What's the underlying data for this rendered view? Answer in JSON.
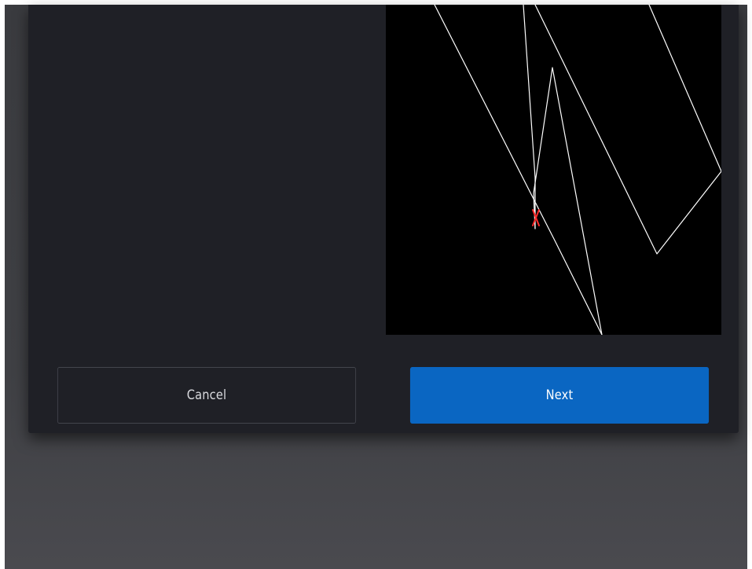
{
  "dialog": {
    "buttons": {
      "cancel_label": "Cancel",
      "next_label": "Next"
    }
  },
  "preview": {
    "background_color": "#000000",
    "line_color": "#ffffff",
    "marker_color": "#ff2a2a",
    "marker_icon": "x-marker-icon"
  },
  "colors": {
    "dialog_background": "#1f2026",
    "accent": "#0a66c2",
    "backdrop": "#3f4044"
  }
}
